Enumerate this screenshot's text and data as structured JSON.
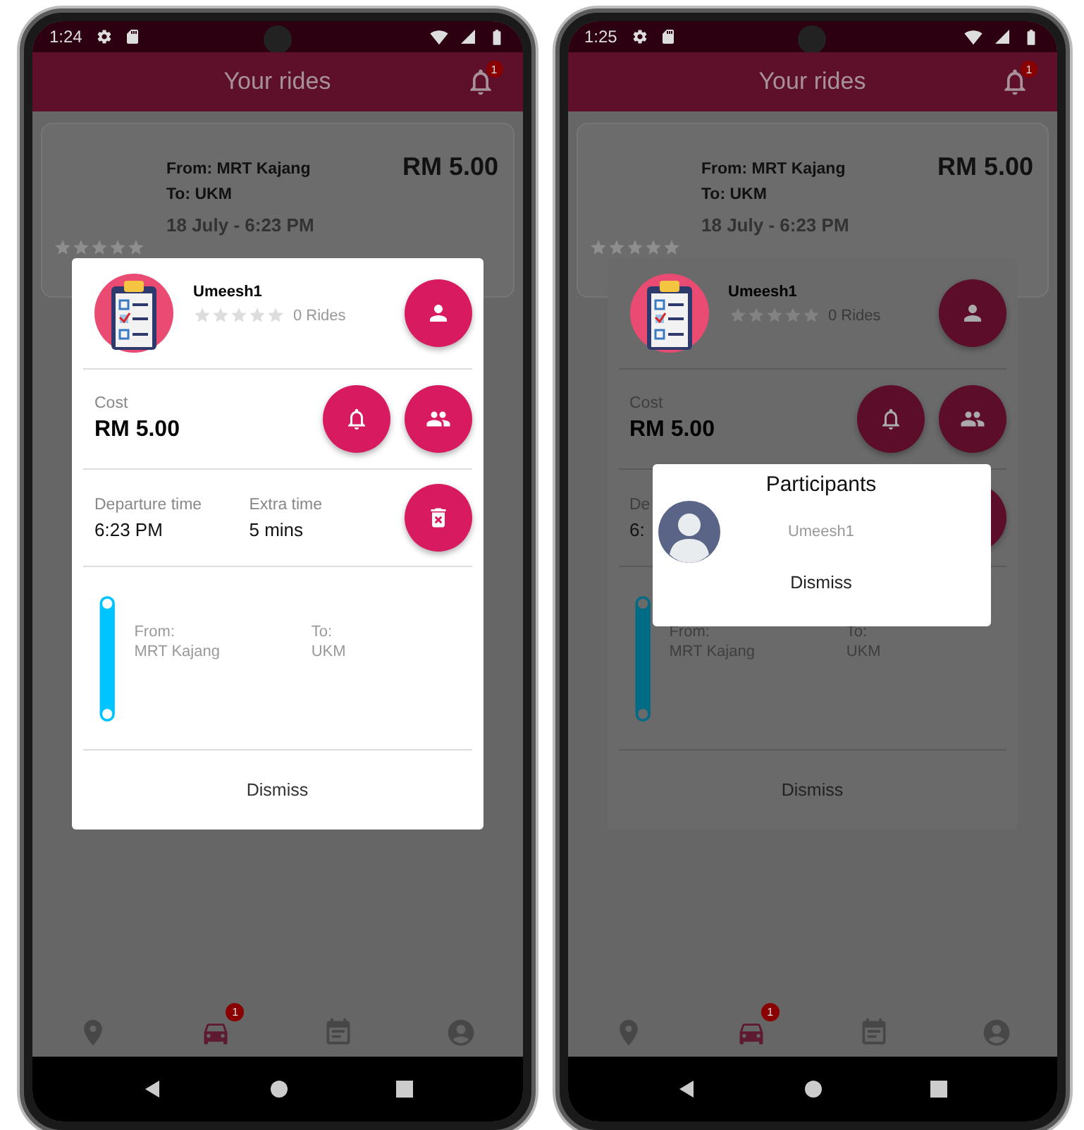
{
  "screens": [
    {
      "dimmed": false,
      "status_bar": {
        "time": "1:24"
      },
      "app_bar": {
        "title": "Your rides",
        "badge": "1"
      },
      "ride_card": {
        "from": "From: MRT Kajang",
        "to": "To: UKM",
        "date": "18 July - 6:23 PM",
        "price": "RM 5.00",
        "stars": 0
      },
      "ride_dialog": {
        "driver_name": "Umeesh1",
        "stars": 0,
        "rides": "0 Rides",
        "cost_label": "Cost",
        "cost": "RM 5.00",
        "departure_label": "Departure time",
        "departure": "6:23 PM",
        "extra_label": "Extra time",
        "extra": "5 mins",
        "from_label": "From:",
        "from": "MRT Kajang",
        "to_label": "To:",
        "to": "UKM",
        "dismiss": "Dismiss"
      },
      "bottom_nav": [
        {
          "kind": "location",
          "selected": false
        },
        {
          "kind": "car",
          "selected": true,
          "badge": "1"
        },
        {
          "kind": "calendar",
          "selected": false
        },
        {
          "kind": "account",
          "selected": false
        }
      ]
    },
    {
      "dimmed": true,
      "status_bar": {
        "time": "1:25"
      },
      "app_bar": {
        "title": "Your rides",
        "badge": "1"
      },
      "ride_card": {
        "from": "From: MRT Kajang",
        "to": "To: UKM",
        "date": "18 July - 6:23 PM",
        "price": "RM 5.00",
        "stars": 0
      },
      "ride_dialog": {
        "driver_name": "Umeesh1",
        "stars": 0,
        "rides": "0 Rides",
        "cost_label": "Cost",
        "cost": "RM 5.00",
        "departure_label": "De",
        "departure": "6:",
        "from_label": "From:",
        "from": "MRT Kajang",
        "to_label": "To:",
        "to": "UKM",
        "dismiss": "Dismiss"
      },
      "participants_dialog": {
        "title": "Participants",
        "participants": [
          {
            "name": "Umeesh1"
          }
        ],
        "dismiss": "Dismiss"
      },
      "bottom_nav": [
        {
          "kind": "location",
          "selected": false
        },
        {
          "kind": "car",
          "selected": true,
          "badge": "1"
        },
        {
          "kind": "calendar",
          "selected": false
        },
        {
          "kind": "account",
          "selected": false
        }
      ]
    }
  ]
}
